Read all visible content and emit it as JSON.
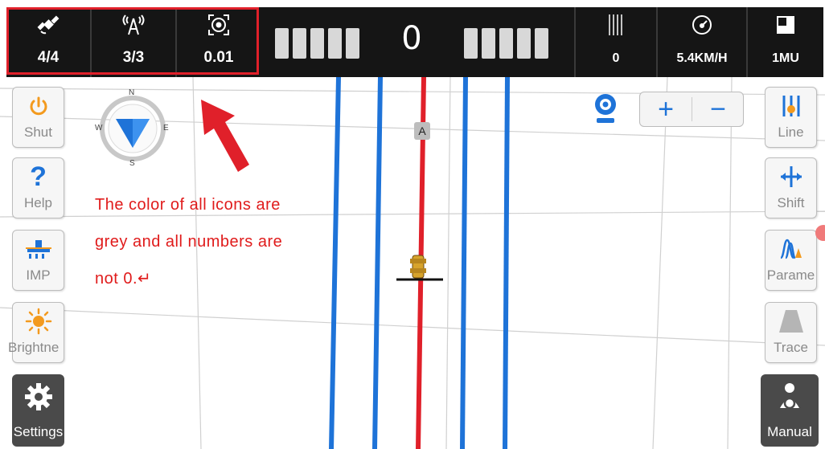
{
  "top_bar": {
    "satellites": {
      "icon": "satellite-icon",
      "value": "4/4"
    },
    "base_station": {
      "icon": "antenna-icon",
      "value": "3/3"
    },
    "precision": {
      "icon": "target-icon",
      "value": "0.01"
    },
    "deviation": {
      "value": "0"
    },
    "rows": {
      "icon": "rows-icon",
      "value": "0"
    },
    "speed": {
      "icon": "speedometer-icon",
      "value": "5.4KM/H"
    },
    "implement": {
      "icon": "implement-icon",
      "value": "1MU"
    }
  },
  "left_buttons": [
    {
      "icon": "power-icon",
      "label": "Shut"
    },
    {
      "icon": "question-icon",
      "label": "Help"
    },
    {
      "icon": "imp-icon",
      "label": "IMP"
    },
    {
      "icon": "sun-icon",
      "label": "Brightne"
    },
    {
      "icon": "gear-icon",
      "label": "Settings"
    }
  ],
  "right_buttons": [
    {
      "icon": "line-icon",
      "label": "Line"
    },
    {
      "icon": "shift-icon",
      "label": "Shift"
    },
    {
      "icon": "param-icon",
      "label": "Parame"
    },
    {
      "icon": "trace-icon",
      "label": "Trace"
    },
    {
      "icon": "driver-icon",
      "label": "Manual"
    }
  ],
  "compass": {
    "n": "N",
    "s": "S",
    "e": "E",
    "w": "W"
  },
  "map": {
    "line_label": "A"
  },
  "zoom": {
    "plus": "+",
    "minus": "−"
  },
  "annotation": {
    "line1": "The color of all icons are",
    "line2": "grey and all numbers are",
    "line3": "not 0.↵"
  },
  "colors": {
    "accent_blue": "#1e73d8",
    "guide_red": "#e0202a",
    "annotation_red": "#e01b1b",
    "bar_bg": "#151515"
  }
}
